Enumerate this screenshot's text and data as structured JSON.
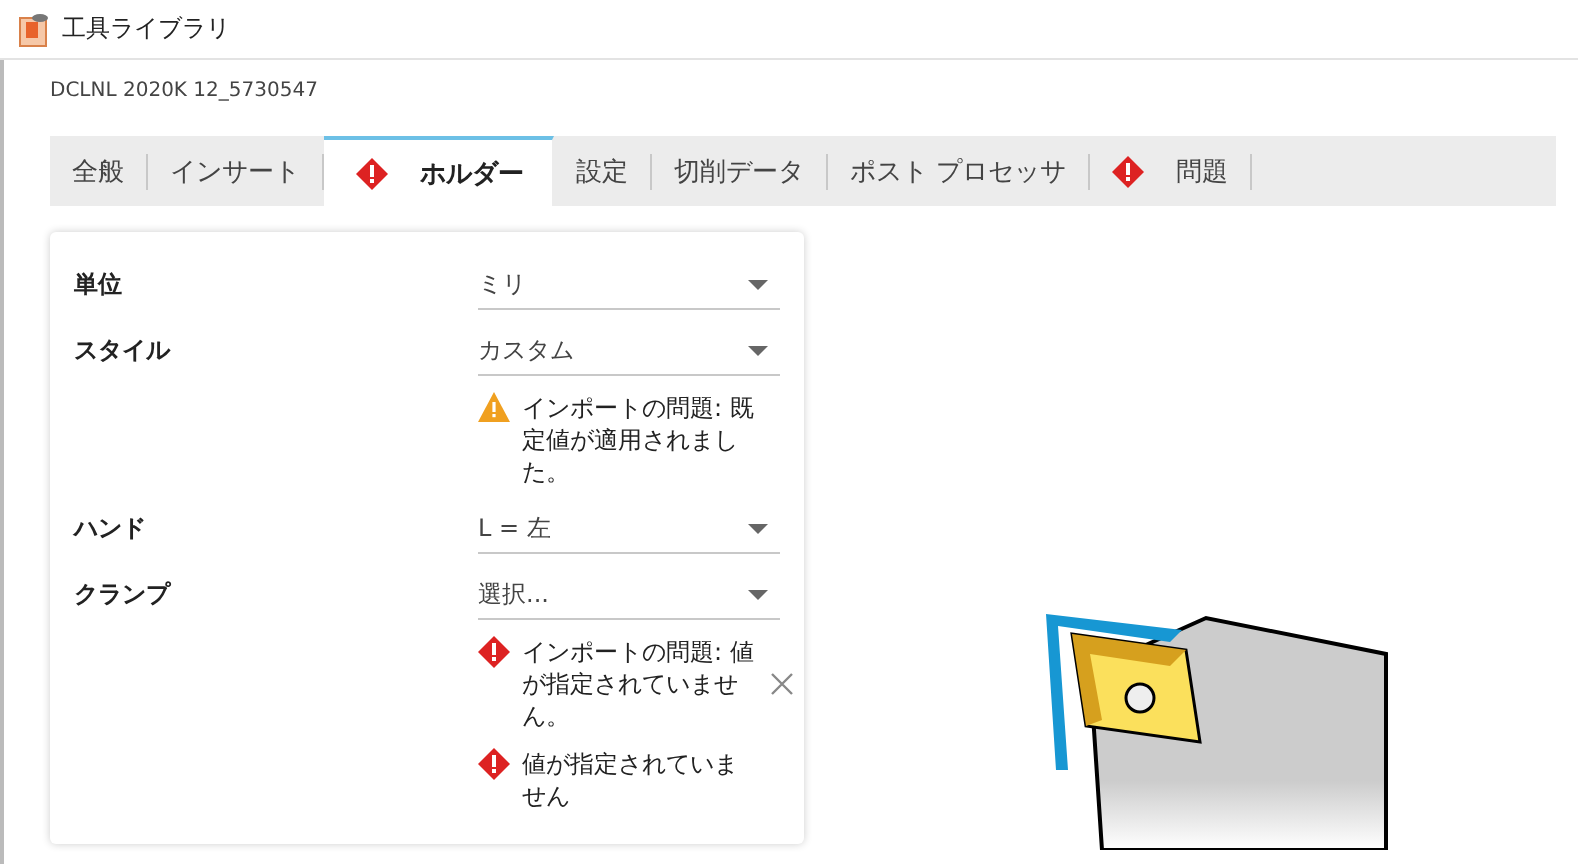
{
  "window": {
    "title": "工具ライブラリ"
  },
  "tool_name": "DCLNL 2020K 12_5730547",
  "tabs": [
    {
      "label": "全般",
      "selected": false,
      "alert": false
    },
    {
      "label": "インサート",
      "selected": false,
      "alert": false
    },
    {
      "label": "ホルダー",
      "selected": true,
      "alert": true
    },
    {
      "label": "設定",
      "selected": false,
      "alert": false
    },
    {
      "label": "切削データ",
      "selected": false,
      "alert": false
    },
    {
      "label": "ポスト プロセッサ",
      "selected": false,
      "alert": false
    },
    {
      "label": "問題",
      "selected": false,
      "alert": true
    }
  ],
  "fields": [
    {
      "label": "単位",
      "value": "ミリ"
    },
    {
      "label": "スタイル",
      "value": "カスタム",
      "messages": [
        {
          "kind": "warning",
          "text": "インポートの問題: 既定値が適用されました。",
          "dismissible": false
        }
      ]
    },
    {
      "label": "ハンド",
      "value": "L = 左"
    },
    {
      "label": "クランプ",
      "value": "選択...",
      "messages": [
        {
          "kind": "error",
          "text": "インポートの問題: 値が指定されていません。",
          "dismissible": true
        },
        {
          "kind": "error",
          "text": "値が指定されていません",
          "dismissible": false
        }
      ]
    }
  ]
}
